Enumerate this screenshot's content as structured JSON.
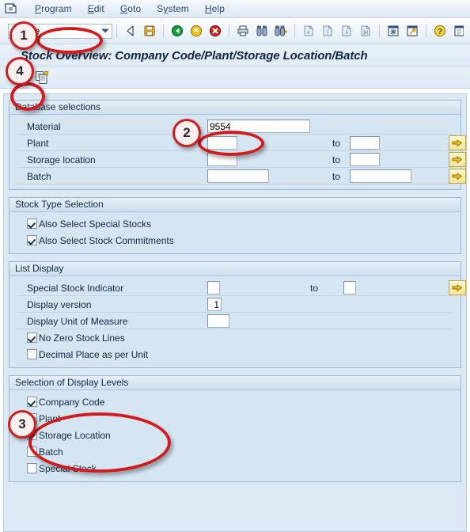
{
  "menubar": {
    "system_icon": "sap-system-menu-icon",
    "items": [
      {
        "label": "Program",
        "accel": "P"
      },
      {
        "label": "Edit",
        "accel": "E"
      },
      {
        "label": "Goto",
        "accel": "G"
      },
      {
        "label": "System",
        "accel": "y"
      },
      {
        "label": "Help",
        "accel": "H"
      }
    ]
  },
  "toolbar": {
    "command_field_value": "mmbe",
    "command_field_placeholder": "",
    "dropdown_icon": "chevron-down-icon",
    "buttons": [
      {
        "name": "back-button",
        "icon": "green-left-arrow-icon",
        "tooltip": "Back"
      },
      {
        "name": "save-button",
        "icon": "save-disk-icon",
        "tooltip": "Save"
      },
      {
        "name": "exit-button",
        "icon": "green-back-arrow-icon",
        "tooltip": "Exit"
      },
      {
        "name": "cancel-button",
        "icon": "yellow-up-arrow-icon",
        "tooltip": "Cancel"
      },
      {
        "name": "stop-button",
        "icon": "red-cross-icon",
        "tooltip": "Cancel"
      },
      {
        "name": "print-button",
        "icon": "printer-icon",
        "tooltip": "Print"
      },
      {
        "name": "find-button",
        "icon": "binoculars-icon",
        "tooltip": "Find"
      },
      {
        "name": "find-next-button",
        "icon": "binoculars-plus-icon",
        "tooltip": "Find Next"
      },
      {
        "name": "first-page-button",
        "icon": "first-page-icon",
        "tooltip": "First Page"
      },
      {
        "name": "previous-page-button",
        "icon": "previous-page-icon",
        "tooltip": "Previous Page"
      },
      {
        "name": "next-page-button",
        "icon": "next-page-icon",
        "tooltip": "Next Page"
      },
      {
        "name": "last-page-button",
        "icon": "last-page-icon",
        "tooltip": "Last Page"
      },
      {
        "name": "create-session-button",
        "icon": "new-session-icon",
        "tooltip": "Create New Session"
      },
      {
        "name": "create-shortcut-button",
        "icon": "shortcut-arrow-icon",
        "tooltip": "Create Shortcut"
      },
      {
        "name": "help-button",
        "icon": "question-mark-icon",
        "tooltip": "Help"
      },
      {
        "name": "customize-button",
        "icon": "customize-local-layout-icon",
        "tooltip": "Customize Local Layout"
      }
    ]
  },
  "title": "Stock Overview: Company Code/Plant/Storage Location/Batch",
  "apptoolbar": {
    "buttons": [
      {
        "name": "execute-button",
        "icon": "clock-check-execute-icon",
        "tooltip": "Execute"
      },
      {
        "name": "get-variant-button",
        "icon": "copy-documents-icon",
        "tooltip": "Get Variant"
      }
    ]
  },
  "groups": {
    "database_selections": {
      "title": "Database selections",
      "rows": [
        {
          "label": "Material",
          "value": "9554",
          "to_label": "",
          "to_value": "",
          "has_arrow": false,
          "field_width": 130
        },
        {
          "label": "Plant",
          "value": "",
          "to_label": "to",
          "to_value": "",
          "has_arrow": true,
          "field_width": 38
        },
        {
          "label": "Storage location",
          "value": "",
          "to_label": "to",
          "to_value": "",
          "has_arrow": true,
          "field_width": 38
        },
        {
          "label": "Batch",
          "value": "",
          "to_label": "to",
          "to_value": "",
          "has_arrow": true,
          "field_width": 78
        }
      ]
    },
    "stock_type_selection": {
      "title": "Stock Type Selection",
      "checkboxes": [
        {
          "label": "Also Select Special Stocks",
          "checked": true
        },
        {
          "label": "Also Select Stock Commitments",
          "checked": true
        }
      ]
    },
    "list_display": {
      "title": "List Display",
      "rows": [
        {
          "label": "Special Stock Indicator",
          "value": "",
          "to_label": "to",
          "to_value": "",
          "has_arrow": true,
          "field_width": 16
        },
        {
          "label": "Display version",
          "value": "1",
          "to_label": "",
          "to_value": "",
          "has_arrow": false,
          "field_width": 16
        },
        {
          "label": "Display Unit of Measure",
          "value": "",
          "to_label": "",
          "to_value": "",
          "has_arrow": false,
          "field_width": 26
        }
      ],
      "checkboxes": [
        {
          "label": "No Zero Stock Lines",
          "checked": true
        },
        {
          "label": "Decimal Place as per Unit",
          "checked": false
        }
      ]
    },
    "selection_of_display_levels": {
      "title": "Selection of Display Levels",
      "checkboxes": [
        {
          "label": "Company Code",
          "checked": true
        },
        {
          "label": "Plant",
          "checked": true
        },
        {
          "label": "Storage Location",
          "checked": true
        },
        {
          "label": "Batch",
          "checked": false
        },
        {
          "label": "Special Stock",
          "checked": false
        }
      ]
    }
  },
  "annotations": [
    {
      "number": "1",
      "target": "command-field"
    },
    {
      "number": "2",
      "target": "material-field"
    },
    {
      "number": "3",
      "target": "display-levels-checkboxes"
    },
    {
      "number": "4",
      "target": "execute-button"
    }
  ],
  "colors": {
    "annotation_red": "#cc1f22",
    "panel_blue": "#d5e5f2",
    "screen_blue": "#dce9f4",
    "title_text": "#12263f"
  }
}
